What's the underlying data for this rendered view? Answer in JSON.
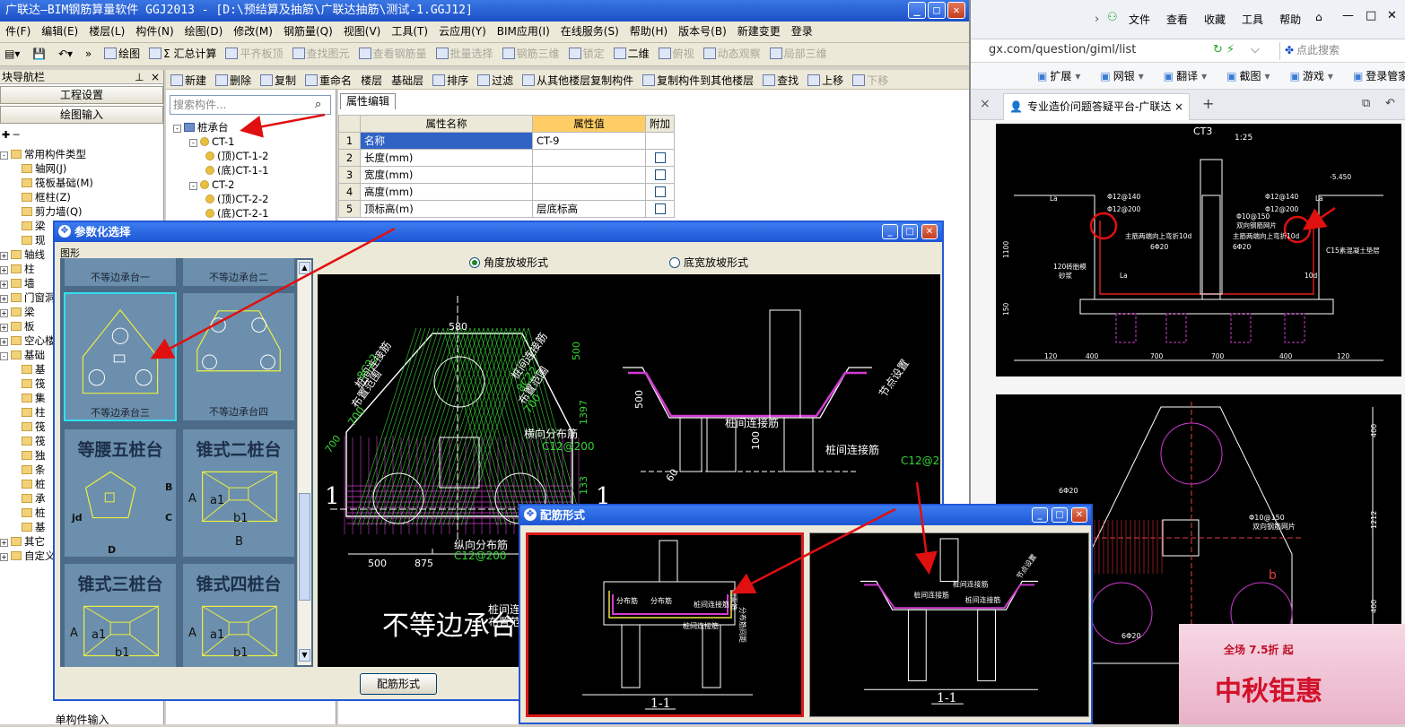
{
  "app": {
    "title": "广联达—BIM钢筋算量软件 GGJ2013 - [D:\\预结算及抽筋\\广联达抽筋\\测试-1.GGJ12]",
    "menus": [
      "件(F)",
      "编辑(E)",
      "楼层(L)",
      "构件(N)",
      "绘图(D)",
      "修改(M)",
      "钢筋量(Q)",
      "视图(V)",
      "工具(T)",
      "云应用(Y)",
      "BIM应用(I)",
      "在线服务(S)",
      "帮助(H)",
      "版本号(B)",
      "新建变更",
      "登录"
    ]
  },
  "toolbar1": {
    "items": [
      "绘图",
      "Σ 汇总计算",
      "平齐板顶",
      "查找图元",
      "查看钢筋量",
      "批量选择",
      "钢筋三维",
      "锁定",
      "二维",
      "俯视",
      "动态观察",
      "局部三维"
    ],
    "disabled": [
      "平齐板顶",
      "查找图元",
      "查看钢筋量",
      "批量选择",
      "钢筋三维",
      "锁定",
      "俯视",
      "动态观察",
      "局部三维"
    ]
  },
  "toolbar2": {
    "items": [
      "新建",
      "删除",
      "复制",
      "重命名",
      "楼层",
      "基础层",
      "排序",
      "过滤",
      "从其他楼层复制构件",
      "复制构件到其他楼层",
      "查找",
      "上移",
      "下移"
    ]
  },
  "navigator": {
    "title": "块导航栏",
    "buttons": [
      "工程设置",
      "绘图输入"
    ],
    "tree": [
      {
        "label": "常用构件类型",
        "indent": 0,
        "pm": "-"
      },
      {
        "label": "轴网(J)",
        "indent": 2
      },
      {
        "label": "筏板基础(M)",
        "indent": 2
      },
      {
        "label": "框柱(Z)",
        "indent": 2
      },
      {
        "label": "剪力墙(Q)",
        "indent": 2
      },
      {
        "label": "梁",
        "indent": 2
      },
      {
        "label": "现",
        "indent": 2
      },
      {
        "label": "轴线",
        "indent": 0,
        "pm": "+"
      },
      {
        "label": "柱",
        "indent": 0,
        "pm": "+"
      },
      {
        "label": "墙",
        "indent": 0,
        "pm": "+"
      },
      {
        "label": "门窗洞",
        "indent": 0,
        "pm": "+"
      },
      {
        "label": "梁",
        "indent": 0,
        "pm": "+"
      },
      {
        "label": "板",
        "indent": 0,
        "pm": "+"
      },
      {
        "label": "空心楼",
        "indent": 0,
        "pm": "+"
      },
      {
        "label": "基础",
        "indent": 0,
        "pm": "-"
      },
      {
        "label": "基",
        "indent": 2
      },
      {
        "label": "筏",
        "indent": 2
      },
      {
        "label": "集",
        "indent": 2
      },
      {
        "label": "柱",
        "indent": 2
      },
      {
        "label": "筏",
        "indent": 2
      },
      {
        "label": "筏",
        "indent": 2
      },
      {
        "label": "独",
        "indent": 2
      },
      {
        "label": "条",
        "indent": 2
      },
      {
        "label": "桩",
        "indent": 2
      },
      {
        "label": "承",
        "indent": 2
      },
      {
        "label": "桩",
        "indent": 2
      },
      {
        "label": "基",
        "indent": 2
      },
      {
        "label": "其它",
        "indent": 0,
        "pm": "+"
      },
      {
        "label": "自定义",
        "indent": 0,
        "pm": "+"
      }
    ],
    "bottom": "单构件输入"
  },
  "component_list": {
    "search_placeholder": "搜索构件...",
    "tree": [
      {
        "label": "桩承台",
        "indent": 0
      },
      {
        "label": "CT-1",
        "indent": 1
      },
      {
        "label": "(顶)CT-1-2",
        "indent": 2
      },
      {
        "label": "(底)CT-1-1",
        "indent": 2
      },
      {
        "label": "CT-2",
        "indent": 1
      },
      {
        "label": "(顶)CT-2-2",
        "indent": 2
      },
      {
        "label": "(底)CT-2-1",
        "indent": 2
      }
    ]
  },
  "properties": {
    "tab": "属性编辑",
    "headers": [
      "属性名称",
      "属性值",
      "附加"
    ],
    "rows": [
      {
        "n": "1",
        "name": "名称",
        "value": "CT-9",
        "check": false
      },
      {
        "n": "2",
        "name": "长度(mm)",
        "value": "",
        "check": true
      },
      {
        "n": "3",
        "name": "宽度(mm)",
        "value": "",
        "check": true
      },
      {
        "n": "4",
        "name": "高度(mm)",
        "value": "",
        "check": true
      },
      {
        "n": "5",
        "name": "顶标高(m)",
        "value": "层底标高",
        "check": true
      }
    ]
  },
  "param_dialog": {
    "title": "参数化选择",
    "group_label": "图形",
    "radio_options": [
      "角度放坡形式",
      "底宽放坡形式"
    ],
    "selected_radio": "角度放坡形式",
    "tiles": [
      {
        "label": "不等边承台一",
        "big": false
      },
      {
        "label": "不等边承台二",
        "big": false
      },
      {
        "label": "不等边承台三",
        "big": false,
        "selected": true
      },
      {
        "label": "不等边承台四",
        "big": false
      },
      {
        "label": "等腰五桩台",
        "big": true
      },
      {
        "label": "锥式二桩台",
        "big": true
      },
      {
        "label": "锥式三桩台",
        "big": true
      },
      {
        "label": "锥式四桩台",
        "big": true
      }
    ],
    "tile_dims": {
      "pentagon": {
        "b": "B",
        "c": "C",
        "d": "D",
        "jd": "jd"
      },
      "cone": {
        "a": "A",
        "a1": "a1",
        "b1": "b1",
        "b": "B"
      }
    },
    "button": "配筋形式",
    "drawing": {
      "big_title": "不等边承台",
      "section_marks": [
        "1",
        "1"
      ],
      "labels": [
        "580",
        "500",
        "1397",
        "133",
        "700",
        "500",
        "875",
        "60",
        "100",
        "500"
      ],
      "rebar_labels": [
        "桩间连接筋",
        "8C22",
        "布置范围",
        "700",
        "桩间连接筋",
        "8C22",
        "布置范围",
        "700",
        "横向分布筋",
        "C12@200",
        "纵向分布筋",
        "C12@200",
        "桩间连接筋",
        "布置范围",
        "桩间连接筋",
        "桩间连接筋",
        "C12@200",
        "节点设置"
      ]
    }
  },
  "rebar_dialog": {
    "title": "配筋形式",
    "panels": [
      {
        "caption": "1-1",
        "labels": [
          "分布筋",
          "分布筋",
          "桩间连接筋",
          "桩间连接筋",
          "侧面筋",
          "分布筋间距"
        ],
        "selected": true
      },
      {
        "caption": "1-1",
        "labels": [
          "桩间连接筋",
          "桩间连接筋",
          "节点设置",
          "桩间连接筋"
        ],
        "selected": false
      }
    ]
  },
  "browser": {
    "menu": [
      "文件",
      "查看",
      "收藏",
      "工具",
      "帮助"
    ],
    "url": "gx.com/question/giml/list",
    "search_placeholder": "点此搜索",
    "bookmarks": [
      "扩展",
      "网银",
      "翻译",
      "截图",
      "游戏",
      "登录管家"
    ],
    "tab_title": "专业造价问题答疑平台-广联达",
    "drawing1": {
      "title": "CT3",
      "scale": "1:25",
      "labels": [
        "-5.450",
        "La",
        "La",
        "Φ12@140",
        "Φ12@200",
        "Φ10@150",
        "Φ12@140",
        "Φ12@200",
        "双向钢筋网片",
        "主筋两端向上弯折10d",
        "主筋两端向上弯折10d",
        "6Φ20",
        "6Φ20",
        "C15素混凝土垫层",
        "120砖胎模",
        "砂浆",
        "1100",
        "150",
        "120",
        "400",
        "700",
        "700",
        "400",
        "120",
        "La",
        "10d"
      ]
    },
    "drawing2": {
      "labels": [
        "6Φ20",
        "Φ10@150",
        "双向钢筋网片",
        "6Φ20",
        "400",
        "1212",
        "400",
        "b"
      ]
    },
    "ad": {
      "text": "中秋钜惠",
      "badge": "全场 7.5折 起"
    }
  },
  "colors": {
    "xp_title": "#1d56d4",
    "selected_cell": "#3163c5",
    "header_highlight": "#ffcc66",
    "annotation_arrow": "#e01010"
  }
}
